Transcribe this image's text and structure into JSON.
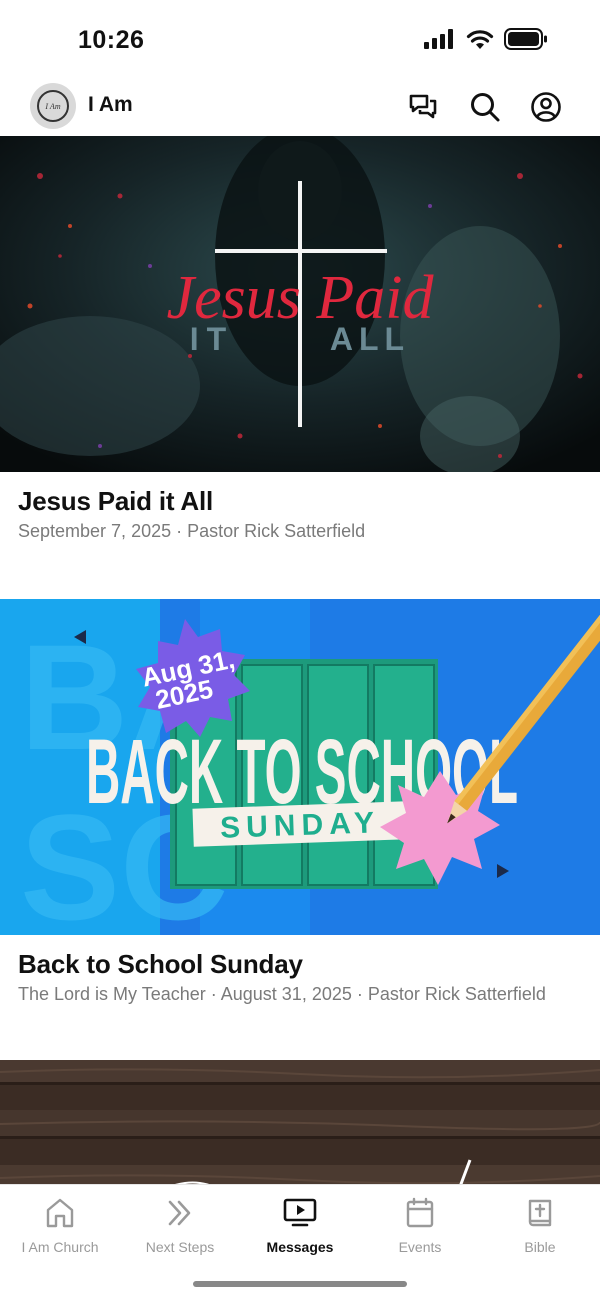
{
  "status_bar": {
    "time": "10:26"
  },
  "header": {
    "title": "I Am",
    "logo_text": "I Am"
  },
  "feed": [
    {
      "title": "Jesus Paid it All",
      "meta": "September 7, 2025 · Pastor Rick Satterfield",
      "art": {
        "script_text": "Jesus Paid",
        "sub_left": "IT",
        "sub_right": "ALL"
      }
    },
    {
      "title": "Back to School Sunday",
      "meta": "The Lord is My Teacher · August 31, 2025 · Pastor Rick Satterfield",
      "art": {
        "badge_line1": "Aug 31,",
        "badge_line2": "2025",
        "headline": "BACK TO SCHOOL",
        "ribbon": "SUNDAY"
      }
    }
  ],
  "tabs": [
    {
      "label": "I Am Church",
      "icon": "home-icon",
      "active": false
    },
    {
      "label": "Next Steps",
      "icon": "double-chevron-icon",
      "active": false
    },
    {
      "label": "Messages",
      "icon": "tv-play-icon",
      "active": true
    },
    {
      "label": "Events",
      "icon": "calendar-icon",
      "active": false
    },
    {
      "label": "Bible",
      "icon": "bible-icon",
      "active": false
    }
  ]
}
